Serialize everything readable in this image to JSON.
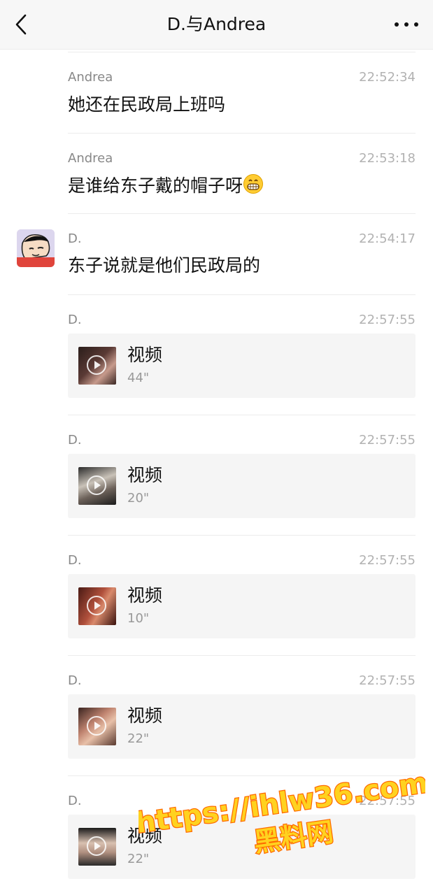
{
  "header": {
    "title": "D.与Andrea",
    "back_icon": "chevron-left-icon",
    "more_icon": "ellipsis-icon"
  },
  "messages": [
    {
      "sender": "Andrea",
      "time": "22:52:34",
      "text": "她还在民政局上班吗"
    },
    {
      "sender": "Andrea",
      "time": "22:53:18",
      "text": "是谁给东子戴的帽子呀",
      "emoji": "grinning-face-icon"
    },
    {
      "sender": "D.",
      "time": "22:54:17",
      "text": "东子说就是他们民政局的"
    },
    {
      "sender": "D.",
      "time": "22:57:55",
      "video_label": "视频",
      "duration": "44\""
    },
    {
      "sender": "D.",
      "time": "22:57:55",
      "video_label": "视频",
      "duration": "20\""
    },
    {
      "sender": "D.",
      "time": "22:57:55",
      "video_label": "视频",
      "duration": "10\""
    },
    {
      "sender": "D.",
      "time": "22:57:55",
      "video_label": "视频",
      "duration": "22\""
    },
    {
      "sender": "D.",
      "time": "22:57:55",
      "video_label": "视频",
      "duration": "22\""
    }
  ],
  "watermark": {
    "line1": "https://ihlw36.com",
    "line2": "黑料网",
    "fill_color": "#ffd21f",
    "stroke_color": "#ff6a00"
  },
  "colors": {
    "nav_background": "#f7f7f7",
    "card_background": "#f5f5f5",
    "divider": "#ececec",
    "meta_text": "#888888",
    "time_text": "#b2b2b2"
  }
}
